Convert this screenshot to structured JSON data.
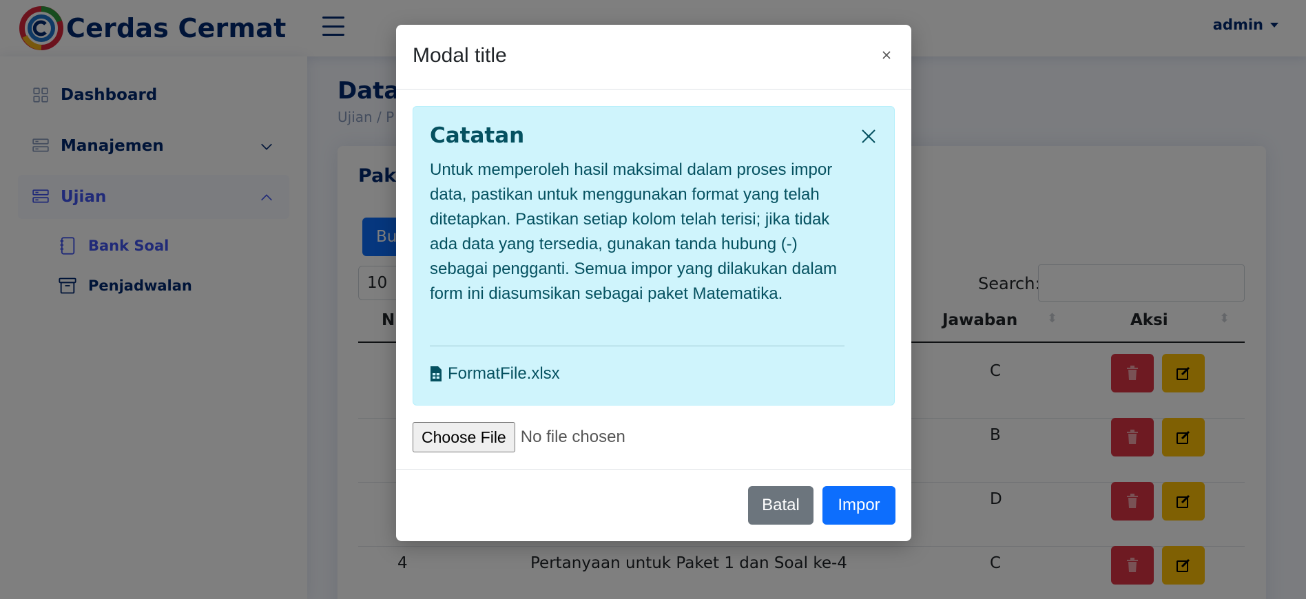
{
  "app": {
    "name": "Cerdas Cermat"
  },
  "header": {
    "user": "admin"
  },
  "sidebar": {
    "items": [
      {
        "label": "Dashboard",
        "icon": "grid-icon"
      },
      {
        "label": "Manajemen",
        "icon": "menu-list-icon"
      },
      {
        "label": "Ujian",
        "icon": "menu-list-icon"
      }
    ],
    "sub_items": [
      {
        "label": "Bank Soal",
        "icon": "journal-icon"
      },
      {
        "label": "Penjadwalan",
        "icon": "archive-icon"
      }
    ]
  },
  "page": {
    "title": "Data",
    "breadcrumb": "Ujian  /  P"
  },
  "card": {
    "title": "Pake",
    "add_button": "Bu",
    "length_value": "10",
    "search_label": "Search:"
  },
  "table": {
    "headers": {
      "no": "N",
      "jawaban": "Jawaban",
      "aksi": "Aksi"
    },
    "rows": [
      {
        "no": "",
        "question": "",
        "answer": "C"
      },
      {
        "no": "",
        "question": "",
        "answer": "B"
      },
      {
        "no": "",
        "question": "",
        "answer": "D"
      },
      {
        "no": "4",
        "question": "Pertanyaan untuk Paket 1 dan Soal ke-4",
        "answer": "C"
      }
    ]
  },
  "modal": {
    "title": "Modal title",
    "alert": {
      "heading": "Catatan",
      "body": "Untuk memperoleh hasil maksimal dalam proses impor data, pastikan untuk menggunakan format yang telah ditetapkan. Pastikan setiap kolom telah terisi; jika tidak ada data yang tersedia, gunakan tanda hubung (-) sebagai pengganti. Semua impor yang dilakukan dalam form ini diasumsikan sebagai paket Matematika.",
      "link": "FormatFile.xlsx"
    },
    "file_button": "Choose File",
    "file_status": "No file chosen",
    "cancel": "Batal",
    "submit": "Impor"
  },
  "colors": {
    "primary": "#0d6efd",
    "navy": "#012970",
    "info_bg": "#cff4fc",
    "info_text": "#055160",
    "danger": "#dc3545",
    "warning": "#ffc107",
    "secondary": "#6c757d"
  }
}
